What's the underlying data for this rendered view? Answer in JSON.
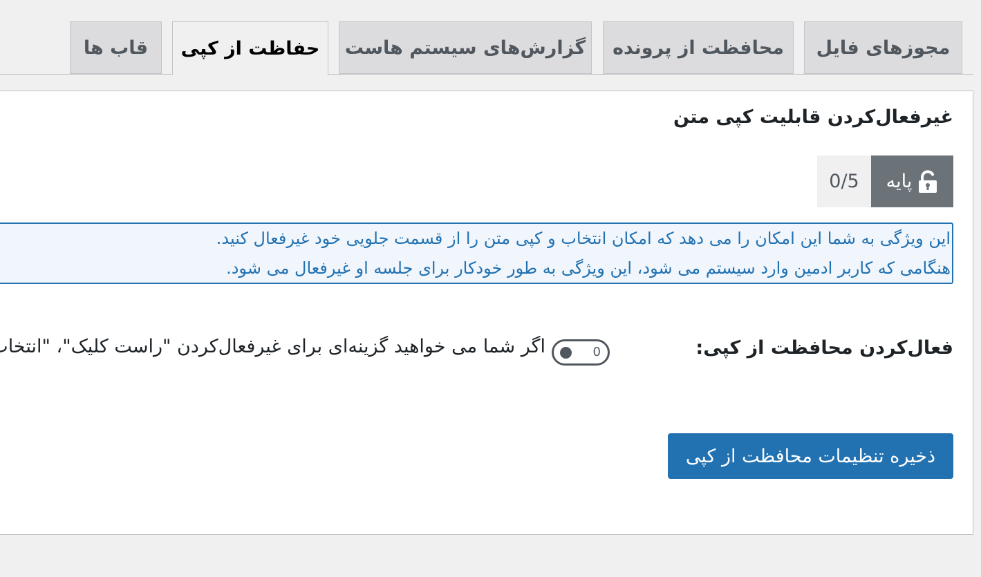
{
  "tabs": [
    {
      "label": "مجوزهای فایل",
      "active": false
    },
    {
      "label": "محافظت از پرونده",
      "active": false
    },
    {
      "label": "گزارش‌های سیستم هاست",
      "active": false
    },
    {
      "label": "حفاظت از کپی",
      "active": true
    },
    {
      "label": "قاب ها",
      "active": false
    }
  ],
  "section": {
    "title": "غیرفعال‌کردن قابلیت کپی متن",
    "badge_label": "پایه",
    "badge_icon": "unlock-icon",
    "badge_count": "0/5"
  },
  "info": {
    "line1": "این ویژگی به شما این امکان را می دهد که امکان انتخاب و کپی متن را از قسمت جلویی خود غیرفعال کنید.",
    "line2": "هنگامی که کاربر ادمین وارد سیستم می شود، این ویژگی به طور خودکار برای جلسه او غیرفعال می شود."
  },
  "setting": {
    "label": "فعال‌کردن محافظت از کپی:",
    "toggle_state_text": "0",
    "toggle_on": false,
    "description": "اگر شما می خواهید گزینه‌ای برای غیرفعال‌کردن \"راست کلیک\"، \"انتخاب متن\" و \"کپی\" داشته باشید"
  },
  "save_button": "ذخیره تنظیمات محافظت از کپی",
  "colors": {
    "accent": "#2271b1",
    "badge_bg": "#6b7379",
    "info_bg": "#f0f6fc"
  }
}
